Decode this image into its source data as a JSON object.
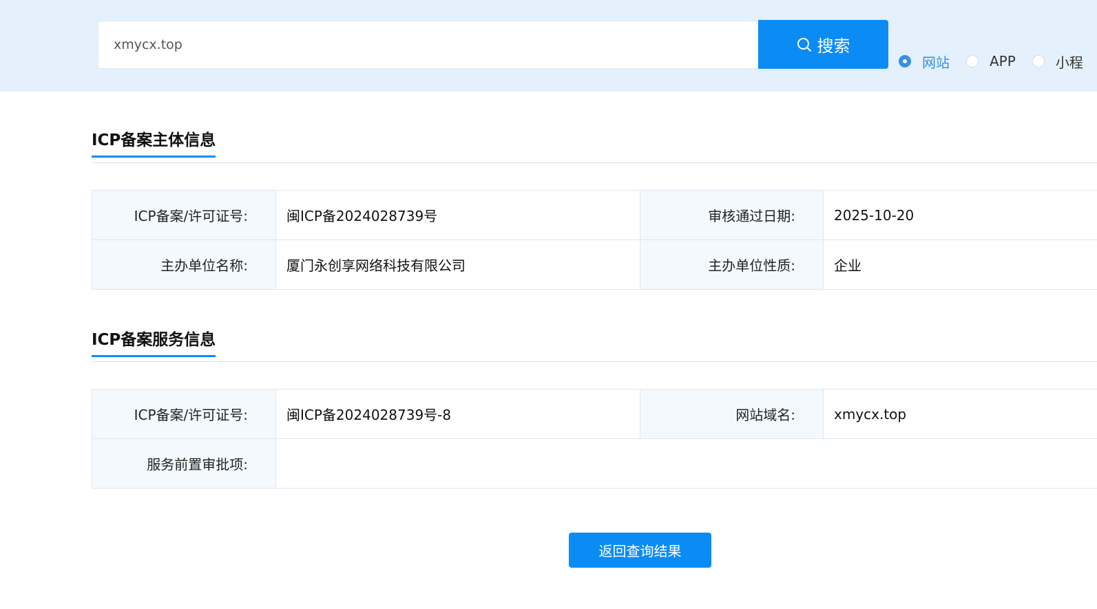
{
  "search": {
    "value": "xmycx.top",
    "button_label": "搜索"
  },
  "radio_options": [
    {
      "label": "网站",
      "checked": true
    },
    {
      "label": "APP",
      "checked": false
    },
    {
      "label": "小程",
      "checked": false
    }
  ],
  "subject_section": {
    "title": "ICP备案主体信息",
    "rows": [
      {
        "label1": "ICP备案/许可证号:",
        "value1": "闽ICP备2024028739号",
        "label2": "审核通过日期:",
        "value2": "2025-10-20"
      },
      {
        "label1": "主办单位名称:",
        "value1": "厦门永创享网络科技有限公司",
        "label2": "主办单位性质:",
        "value2": "企业"
      }
    ]
  },
  "service_section": {
    "title": "ICP备案服务信息",
    "row1": {
      "label1": "ICP备案/许可证号:",
      "value1": "闽ICP备2024028739号-8",
      "label2": "网站域名:",
      "value2": "xmycx.top"
    },
    "row2": {
      "label": "服务前置审批项:",
      "value": ""
    }
  },
  "back_button_label": "返回查询结果",
  "colors": {
    "accent": "#0b8cf5",
    "topbar_bg": "#e4f0fc",
    "label_bg": "#f4f9fd"
  }
}
